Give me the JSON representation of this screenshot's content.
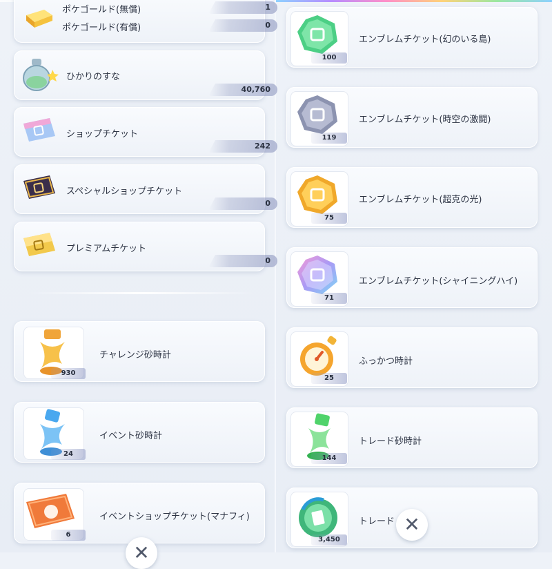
{
  "colors": {
    "accent": "#2a3140",
    "card_bg": "#f3f6fb",
    "pill": "#8c96be"
  },
  "left": {
    "pokegold": {
      "free_label": "ポケゴールド(無償)",
      "free_value": "1",
      "paid_label": "ポケゴールド(有償)",
      "paid_value": "0",
      "icon": "gold-bar-icon"
    },
    "items": [
      {
        "label": "ひかりのすな",
        "value": "40,760",
        "icon": "light-sand-bottle-icon"
      },
      {
        "label": "ショップチケット",
        "value": "242",
        "icon": "shop-ticket-icon"
      },
      {
        "label": "スペシャルショップチケット",
        "value": "0",
        "icon": "special-shop-ticket-icon"
      },
      {
        "label": "プレミアムチケット",
        "value": "0",
        "icon": "premium-ticket-icon"
      }
    ],
    "timers": [
      {
        "label": "チャレンジ砂時計",
        "count": "930",
        "icon": "challenge-hourglass-icon"
      },
      {
        "label": "イベント砂時計",
        "count": "24",
        "icon": "event-hourglass-icon"
      },
      {
        "label": "イベントショップチケット(マナフィ)",
        "count": "6",
        "icon": "event-shop-ticket-icon"
      }
    ]
  },
  "right": {
    "items": [
      {
        "label": "エンブレムチケット(幻のいる島)",
        "count": "100",
        "icon": "emblem-ticket-green-icon"
      },
      {
        "label": "エンブレムチケット(時空の激闘)",
        "count": "119",
        "icon": "emblem-ticket-gray-icon"
      },
      {
        "label": "エンブレムチケット(超克の光)",
        "count": "75",
        "icon": "emblem-ticket-gold-icon"
      },
      {
        "label": "エンブレムチケット(シャイニングハイ)",
        "count": "71",
        "icon": "emblem-ticket-rainbow-icon"
      },
      {
        "label": "ふっかつ時計",
        "count": "25",
        "icon": "revival-watch-icon"
      },
      {
        "label": "トレード砂時計",
        "count": "144",
        "icon": "trade-hourglass-icon"
      },
      {
        "label": "トレード",
        "count": "3,450",
        "icon": "trade-ticket-icon"
      }
    ]
  },
  "close_glyph": "✕"
}
